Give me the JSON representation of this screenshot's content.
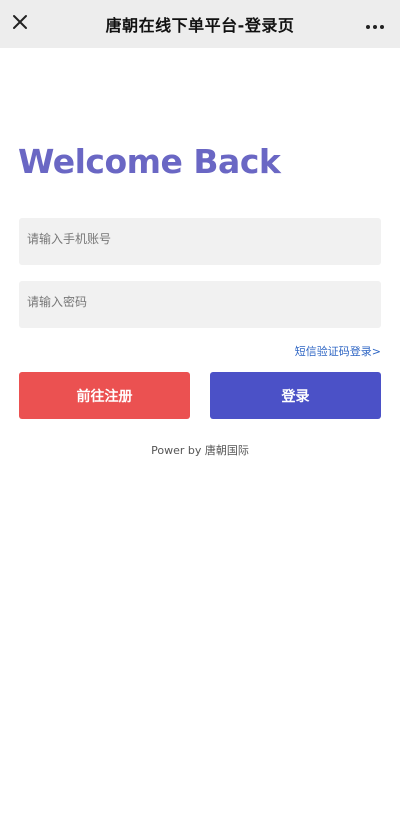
{
  "header": {
    "title": "唐朝在线下单平台-登录页"
  },
  "main": {
    "welcome": "Welcome Back",
    "phone_placeholder": "请输入手机账号",
    "password_placeholder": "请输入密码",
    "sms_login_link": "短信验证码登录>",
    "register_button": "前往注册",
    "login_button": "登录",
    "footer": "Power by 唐朝国际"
  },
  "colors": {
    "accent_text": "#6a67c4",
    "register_bg": "#eb5151",
    "login_bg": "#4b51c7",
    "link": "#2f66c4",
    "input_bg": "#f1f1f1",
    "topbar_bg": "#ededed"
  },
  "icons": {
    "close": "close-icon",
    "more": "more-dots-icon"
  }
}
